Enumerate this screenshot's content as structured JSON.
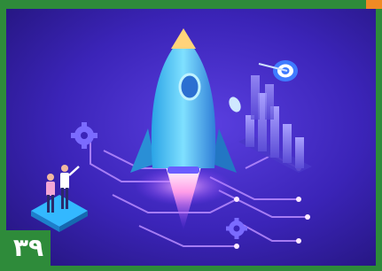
{
  "badge": {
    "number": "۳۹"
  },
  "colors": {
    "frame": "#2e8b3a",
    "accent": "#f08a24",
    "background_dark": "#2a1a8f",
    "background_light": "#5a3fe0",
    "circuit_glow": "#b98cff",
    "rocket_body": "#5fd0ff",
    "rocket_tip": "#ffd37a"
  },
  "illustration": {
    "icons": [
      "rocket-icon",
      "gear-icon",
      "bar-chart-icon",
      "target-icon",
      "people-icon",
      "circuit-icon"
    ]
  }
}
